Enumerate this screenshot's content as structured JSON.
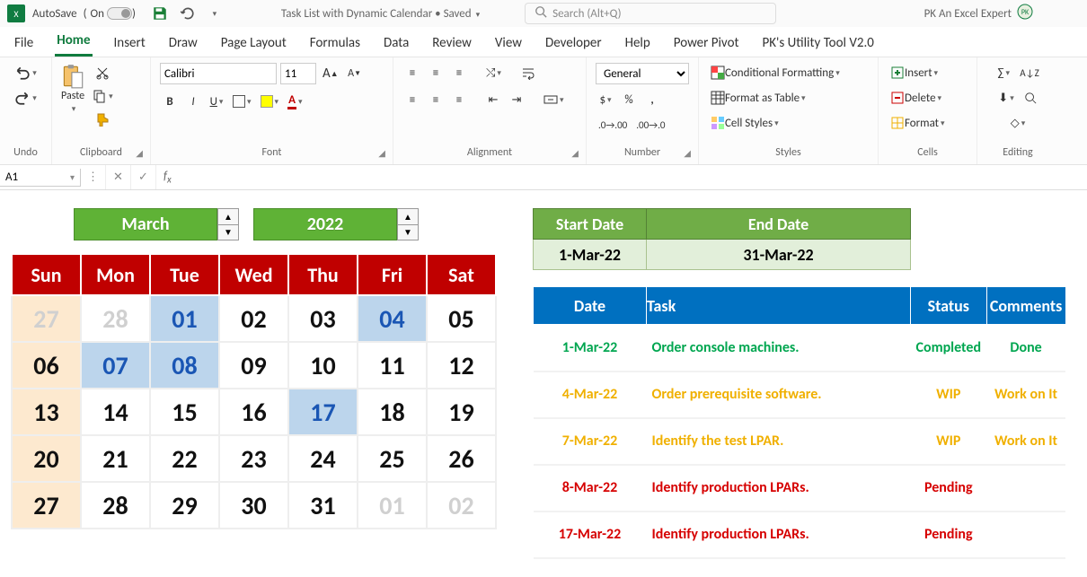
{
  "titlebar": {
    "autosave_label": "AutoSave",
    "autosave_state": "On",
    "doc_title": "Task List with Dynamic Calendar • Saved",
    "search_placeholder": "Search (Alt+Q)",
    "user_name": "PK An Excel Expert"
  },
  "tabs": [
    "File",
    "Home",
    "Insert",
    "Draw",
    "Page Layout",
    "Formulas",
    "Data",
    "Review",
    "View",
    "Developer",
    "Help",
    "Power Pivot",
    "PK's Utility Tool V2.0"
  ],
  "active_tab": "Home",
  "ribbon": {
    "undo": "Undo",
    "clipboard": {
      "label": "Clipboard",
      "paste": "Paste"
    },
    "font": {
      "label": "Font",
      "name": "Calibri",
      "size": "11"
    },
    "alignment": {
      "label": "Alignment"
    },
    "number": {
      "label": "Number",
      "format": "General"
    },
    "styles": {
      "label": "Styles",
      "cond": "Conditional Formatting",
      "table": "Format as Table",
      "cell": "Cell Styles"
    },
    "cells": {
      "label": "Cells",
      "insert": "Insert",
      "delete": "Delete",
      "format": "Format"
    },
    "editing": {
      "label": "Editing"
    }
  },
  "name_box": "A1",
  "calendar": {
    "month": "March",
    "year": "2022",
    "days": [
      "Sun",
      "Mon",
      "Tue",
      "Wed",
      "Thu",
      "Fri",
      "Sat"
    ],
    "weeks": [
      [
        {
          "n": "27",
          "dim": true
        },
        {
          "n": "28",
          "dim": true
        },
        {
          "n": "01",
          "hl": true
        },
        {
          "n": "02"
        },
        {
          "n": "03"
        },
        {
          "n": "04",
          "hl": true
        },
        {
          "n": "05"
        }
      ],
      [
        {
          "n": "06"
        },
        {
          "n": "07",
          "hl": true
        },
        {
          "n": "08",
          "hl": true
        },
        {
          "n": "09"
        },
        {
          "n": "10"
        },
        {
          "n": "11"
        },
        {
          "n": "12"
        }
      ],
      [
        {
          "n": "13"
        },
        {
          "n": "14"
        },
        {
          "n": "15"
        },
        {
          "n": "16"
        },
        {
          "n": "17",
          "hl": true
        },
        {
          "n": "18"
        },
        {
          "n": "19"
        }
      ],
      [
        {
          "n": "20"
        },
        {
          "n": "21"
        },
        {
          "n": "22"
        },
        {
          "n": "23"
        },
        {
          "n": "24"
        },
        {
          "n": "25"
        },
        {
          "n": "26"
        }
      ],
      [
        {
          "n": "27"
        },
        {
          "n": "28"
        },
        {
          "n": "29"
        },
        {
          "n": "30"
        },
        {
          "n": "31"
        },
        {
          "n": "01",
          "dim": true
        },
        {
          "n": "02",
          "dim": true
        }
      ]
    ]
  },
  "range": {
    "header_start": "Start Date",
    "header_end": "End Date",
    "start": "1-Mar-22",
    "end": "31-Mar-22"
  },
  "task_headers": {
    "date": "Date",
    "task": "Task",
    "status": "Status",
    "comments": "Comments"
  },
  "tasks": [
    {
      "date": "1-Mar-22",
      "task": "Order console machines.",
      "status": "Completed",
      "comments": "Done",
      "cls": "st-completed"
    },
    {
      "date": "4-Mar-22",
      "task": "Order prerequisite software.",
      "status": "WIP",
      "comments": "Work on It",
      "cls": "st-wip"
    },
    {
      "date": "7-Mar-22",
      "task": "Identify the test LPAR.",
      "status": "WIP",
      "comments": "Work on It",
      "cls": "st-wip"
    },
    {
      "date": "8-Mar-22",
      "task": "Identify production LPARs.",
      "status": "Pending",
      "comments": "",
      "cls": "st-pending"
    },
    {
      "date": "17-Mar-22",
      "task": "Identify production LPARs.",
      "status": "Pending",
      "comments": "",
      "cls": "st-pending"
    }
  ]
}
